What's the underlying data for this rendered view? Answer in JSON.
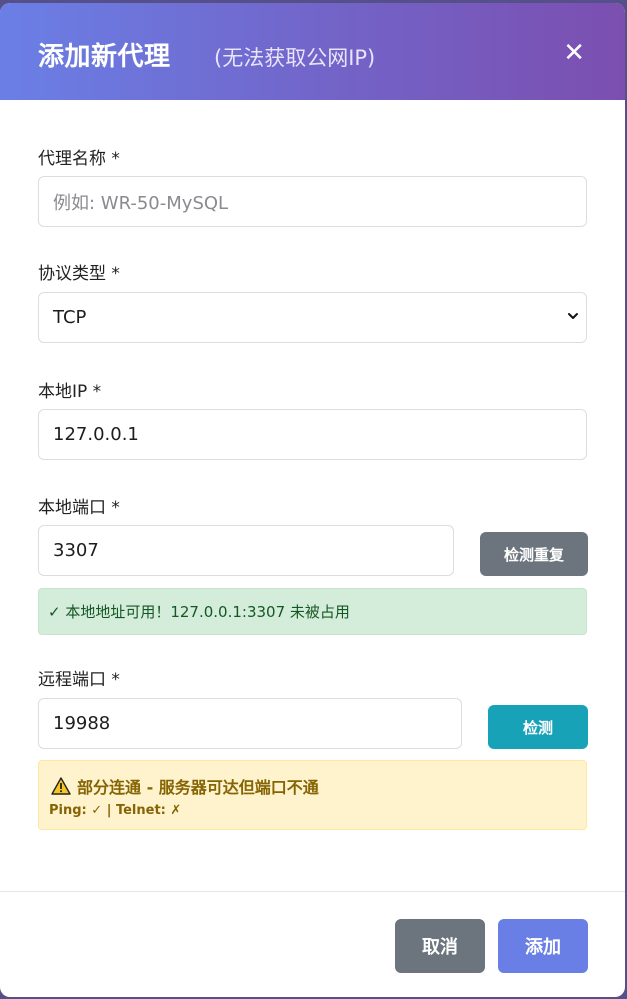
{
  "modal": {
    "title": "添加新代理",
    "subtitle": "(无法获取公网IP)",
    "close_glyph": "✕"
  },
  "fields": {
    "name": {
      "label": "代理名称 *",
      "placeholder": "例如: WR-50-MySQL",
      "value": ""
    },
    "protocol": {
      "label": "协议类型 *",
      "value": "TCP"
    },
    "local_ip": {
      "label": "本地IP *",
      "value": "127.0.0.1"
    },
    "local_port": {
      "label": "本地端口 *",
      "value": "3307",
      "check_button": "检测重复"
    },
    "remote_port": {
      "label": "远程端口 *",
      "value": "19988",
      "check_button": "检测"
    }
  },
  "alerts": {
    "local_port_success": "✓ 本地地址可用！127.0.0.1:3307 未被占用",
    "remote_port_warning_title": "部分连通 - 服务器可达但端口不通",
    "remote_port_warning_detail": "Ping: ✓ | Telnet: ✗"
  },
  "footer": {
    "cancel_label": "取消",
    "add_label": "添加"
  },
  "colors": {
    "header_gradient_start": "#6a7fe6",
    "header_gradient_end": "#7b4fb0",
    "success_bg": "#d4edda",
    "warning_bg": "#fff3cd",
    "teal": "#17a2b8",
    "gray": "#6c757d"
  },
  "icons": [
    "close-icon",
    "chevron-down-icon",
    "warning-icon"
  ]
}
